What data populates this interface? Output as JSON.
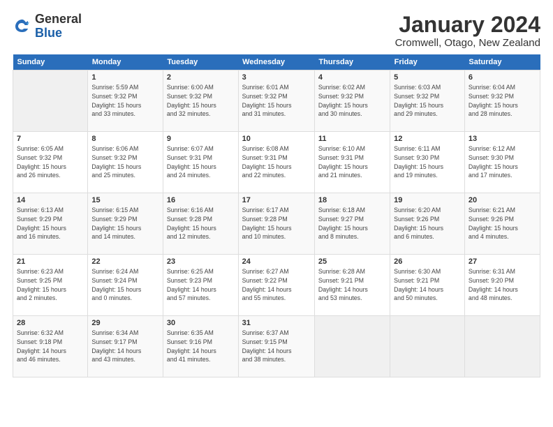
{
  "logo": {
    "general": "General",
    "blue": "Blue"
  },
  "title": "January 2024",
  "location": "Cromwell, Otago, New Zealand",
  "weekdays": [
    "Sunday",
    "Monday",
    "Tuesday",
    "Wednesday",
    "Thursday",
    "Friday",
    "Saturday"
  ],
  "weeks": [
    [
      {
        "day": "",
        "info": ""
      },
      {
        "day": "1",
        "info": "Sunrise: 5:59 AM\nSunset: 9:32 PM\nDaylight: 15 hours\nand 33 minutes."
      },
      {
        "day": "2",
        "info": "Sunrise: 6:00 AM\nSunset: 9:32 PM\nDaylight: 15 hours\nand 32 minutes."
      },
      {
        "day": "3",
        "info": "Sunrise: 6:01 AM\nSunset: 9:32 PM\nDaylight: 15 hours\nand 31 minutes."
      },
      {
        "day": "4",
        "info": "Sunrise: 6:02 AM\nSunset: 9:32 PM\nDaylight: 15 hours\nand 30 minutes."
      },
      {
        "day": "5",
        "info": "Sunrise: 6:03 AM\nSunset: 9:32 PM\nDaylight: 15 hours\nand 29 minutes."
      },
      {
        "day": "6",
        "info": "Sunrise: 6:04 AM\nSunset: 9:32 PM\nDaylight: 15 hours\nand 28 minutes."
      }
    ],
    [
      {
        "day": "7",
        "info": "Sunrise: 6:05 AM\nSunset: 9:32 PM\nDaylight: 15 hours\nand 26 minutes."
      },
      {
        "day": "8",
        "info": "Sunrise: 6:06 AM\nSunset: 9:32 PM\nDaylight: 15 hours\nand 25 minutes."
      },
      {
        "day": "9",
        "info": "Sunrise: 6:07 AM\nSunset: 9:31 PM\nDaylight: 15 hours\nand 24 minutes."
      },
      {
        "day": "10",
        "info": "Sunrise: 6:08 AM\nSunset: 9:31 PM\nDaylight: 15 hours\nand 22 minutes."
      },
      {
        "day": "11",
        "info": "Sunrise: 6:10 AM\nSunset: 9:31 PM\nDaylight: 15 hours\nand 21 minutes."
      },
      {
        "day": "12",
        "info": "Sunrise: 6:11 AM\nSunset: 9:30 PM\nDaylight: 15 hours\nand 19 minutes."
      },
      {
        "day": "13",
        "info": "Sunrise: 6:12 AM\nSunset: 9:30 PM\nDaylight: 15 hours\nand 17 minutes."
      }
    ],
    [
      {
        "day": "14",
        "info": "Sunrise: 6:13 AM\nSunset: 9:29 PM\nDaylight: 15 hours\nand 16 minutes."
      },
      {
        "day": "15",
        "info": "Sunrise: 6:15 AM\nSunset: 9:29 PM\nDaylight: 15 hours\nand 14 minutes."
      },
      {
        "day": "16",
        "info": "Sunrise: 6:16 AM\nSunset: 9:28 PM\nDaylight: 15 hours\nand 12 minutes."
      },
      {
        "day": "17",
        "info": "Sunrise: 6:17 AM\nSunset: 9:28 PM\nDaylight: 15 hours\nand 10 minutes."
      },
      {
        "day": "18",
        "info": "Sunrise: 6:18 AM\nSunset: 9:27 PM\nDaylight: 15 hours\nand 8 minutes."
      },
      {
        "day": "19",
        "info": "Sunrise: 6:20 AM\nSunset: 9:26 PM\nDaylight: 15 hours\nand 6 minutes."
      },
      {
        "day": "20",
        "info": "Sunrise: 6:21 AM\nSunset: 9:26 PM\nDaylight: 15 hours\nand 4 minutes."
      }
    ],
    [
      {
        "day": "21",
        "info": "Sunrise: 6:23 AM\nSunset: 9:25 PM\nDaylight: 15 hours\nand 2 minutes."
      },
      {
        "day": "22",
        "info": "Sunrise: 6:24 AM\nSunset: 9:24 PM\nDaylight: 15 hours\nand 0 minutes."
      },
      {
        "day": "23",
        "info": "Sunrise: 6:25 AM\nSunset: 9:23 PM\nDaylight: 14 hours\nand 57 minutes."
      },
      {
        "day": "24",
        "info": "Sunrise: 6:27 AM\nSunset: 9:22 PM\nDaylight: 14 hours\nand 55 minutes."
      },
      {
        "day": "25",
        "info": "Sunrise: 6:28 AM\nSunset: 9:21 PM\nDaylight: 14 hours\nand 53 minutes."
      },
      {
        "day": "26",
        "info": "Sunrise: 6:30 AM\nSunset: 9:21 PM\nDaylight: 14 hours\nand 50 minutes."
      },
      {
        "day": "27",
        "info": "Sunrise: 6:31 AM\nSunset: 9:20 PM\nDaylight: 14 hours\nand 48 minutes."
      }
    ],
    [
      {
        "day": "28",
        "info": "Sunrise: 6:32 AM\nSunset: 9:18 PM\nDaylight: 14 hours\nand 46 minutes."
      },
      {
        "day": "29",
        "info": "Sunrise: 6:34 AM\nSunset: 9:17 PM\nDaylight: 14 hours\nand 43 minutes."
      },
      {
        "day": "30",
        "info": "Sunrise: 6:35 AM\nSunset: 9:16 PM\nDaylight: 14 hours\nand 41 minutes."
      },
      {
        "day": "31",
        "info": "Sunrise: 6:37 AM\nSunset: 9:15 PM\nDaylight: 14 hours\nand 38 minutes."
      },
      {
        "day": "",
        "info": ""
      },
      {
        "day": "",
        "info": ""
      },
      {
        "day": "",
        "info": ""
      }
    ]
  ]
}
